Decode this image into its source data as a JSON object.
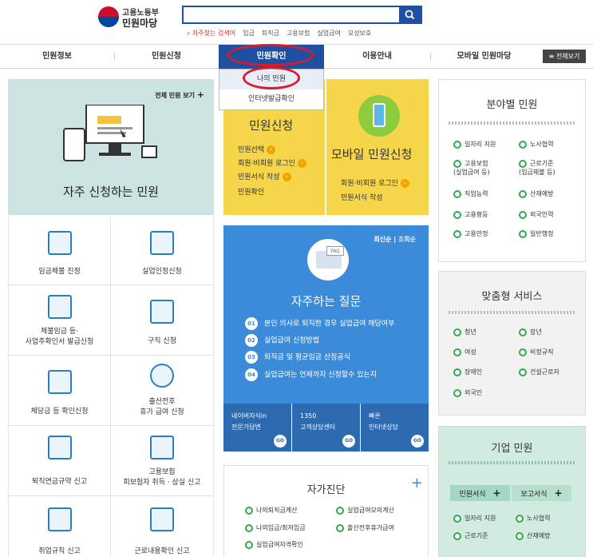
{
  "header": {
    "logo_org": "고용노동부",
    "logo_site": "민원마당",
    "search_placeholder": "",
    "hot_keywords_label": "자주찾는 검색어",
    "keywords": [
      "임금",
      "퇴직금",
      "고용보험",
      "실업급여",
      "모성보호"
    ]
  },
  "gnb": {
    "items": [
      "민원정보",
      "민원신청",
      "민원확인",
      "이용안내",
      "모바일 민원마당"
    ],
    "active": "민원확인",
    "all_menu": "전체보기"
  },
  "dropdown": {
    "items": [
      "나의 민원",
      "인터넷발급확인"
    ]
  },
  "frequent": {
    "view_all": "전체 민원 보기",
    "title": "자주 신청하는 민원",
    "tiles": [
      "임금체불 진정",
      "실업인정신청",
      "체불임금 등·\n사업주확인서 발급신청",
      "구직 신청",
      "체당금 등 확인신청",
      "출산전후\n휴가 급여 신청",
      "퇴직연금규약 신고",
      "고용보험\n피보험자 취득 · 상실 신고",
      "취업규칙 신고",
      "근로내용확인 신고"
    ]
  },
  "apply": {
    "title": "민원신청",
    "items": [
      "민원선택",
      "회원·비회원 로그인",
      "민원서식 작성",
      "민원확인"
    ]
  },
  "mobile": {
    "title": "모바일 민원신청",
    "items": [
      "회원·비회원 로그인",
      "민원서식 작성"
    ]
  },
  "faq": {
    "sort_latest": "최신순",
    "sort_views": "조회순",
    "badge": "FAQ",
    "title": "자주하는 질문",
    "questions": [
      {
        "num": "01",
        "text": "본인 의사로 퇴직한 경우 실업급여 해당여부"
      },
      {
        "num": "02",
        "text": "실업급여 신청방법"
      },
      {
        "num": "03",
        "text": "퇴직금 및 평균임금 산정공식"
      },
      {
        "num": "04",
        "text": "실업급여는 언제까지 신청할수 있는지"
      }
    ],
    "boxes": [
      {
        "line1": "네이버지식in",
        "line2": "전문가답변"
      },
      {
        "line1": "1350",
        "line2": "고객상담센터"
      },
      {
        "line1": "빠른",
        "line2": "인터넷상담"
      }
    ],
    "go": "GO"
  },
  "self": {
    "title": "자가진단",
    "plus": "+",
    "items": [
      "나의퇴직금계산",
      "실업급여모의계산",
      "나의임금/최저임금",
      "출산전후휴가급여",
      "실업급여자격확인"
    ]
  },
  "field": {
    "title": "분야별 민원",
    "items": [
      "일자리 지원",
      "노사협력",
      "고용보험\n(실업급여 등)",
      "근로기준\n(임금체불 등)",
      "직업능력",
      "산재예방",
      "고용평등",
      "외국인력",
      "고용안정",
      "일반행정"
    ]
  },
  "custom": {
    "title": "맞춤형 서비스",
    "items": [
      "청년",
      "장년",
      "여성",
      "비정규직",
      "장애인",
      "건설근로자",
      "외국인"
    ]
  },
  "company": {
    "title": "기업 민원",
    "tab1": "민원서식",
    "tab2": "보고서식",
    "items": [
      "일자리 지원",
      "노사협력",
      "근로기준",
      "산재예방"
    ]
  },
  "colors": {
    "primary": "#1e4fa0",
    "yellow": "#f5d54a",
    "faq_blue": "#3b8bd9",
    "teal": "#cde3e1",
    "highlight_ring": "#d91b2b"
  }
}
